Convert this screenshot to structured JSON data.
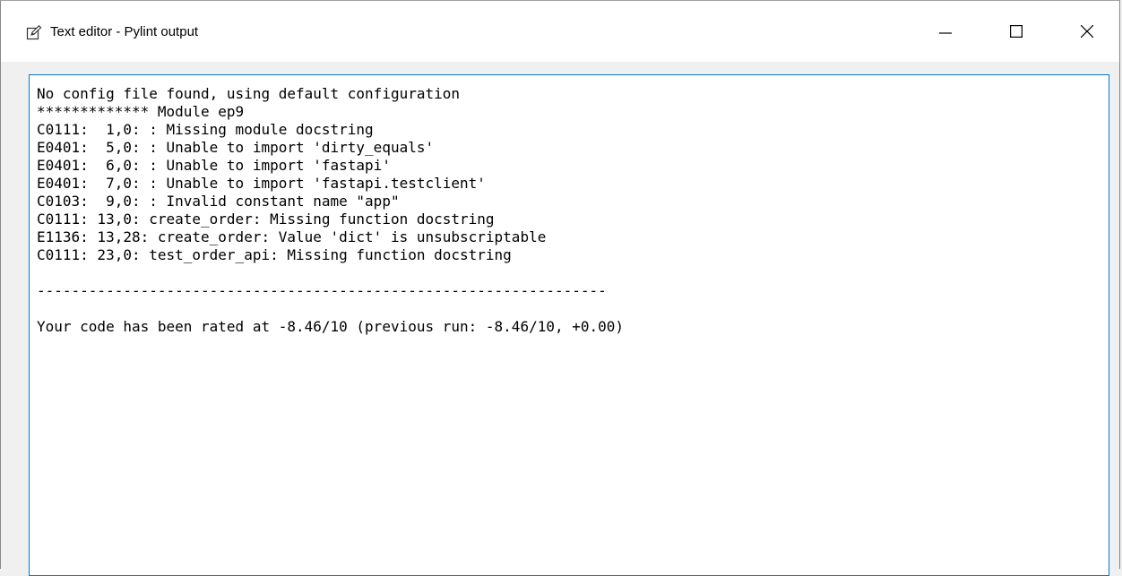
{
  "window": {
    "title": "Text editor - Pylint output",
    "icon": "edit-note-icon"
  },
  "caption_buttons": {
    "minimize": "minimize-icon",
    "maximize": "maximize-icon",
    "close": "close-icon"
  },
  "editor": {
    "lines": [
      "No config file found, using default configuration",
      "************* Module ep9",
      "C0111:  1,0: : Missing module docstring",
      "E0401:  5,0: : Unable to import 'dirty_equals'",
      "E0401:  6,0: : Unable to import 'fastapi'",
      "E0401:  7,0: : Unable to import 'fastapi.testclient'",
      "C0103:  9,0: : Invalid constant name \"app\"",
      "C0111: 13,0: create_order: Missing function docstring",
      "E1136: 13,28: create_order: Value 'dict' is unsubscriptable",
      "C0111: 23,0: test_order_api: Missing function docstring",
      "",
      "------------------------------------------------------------------",
      "",
      "Your code has been rated at -8.46/10 (previous run: -8.46/10, +0.00)"
    ]
  },
  "colors": {
    "focus_border": "#0078d7",
    "window_bg": "#f0f0f0",
    "titlebar_bg": "#ffffff"
  }
}
